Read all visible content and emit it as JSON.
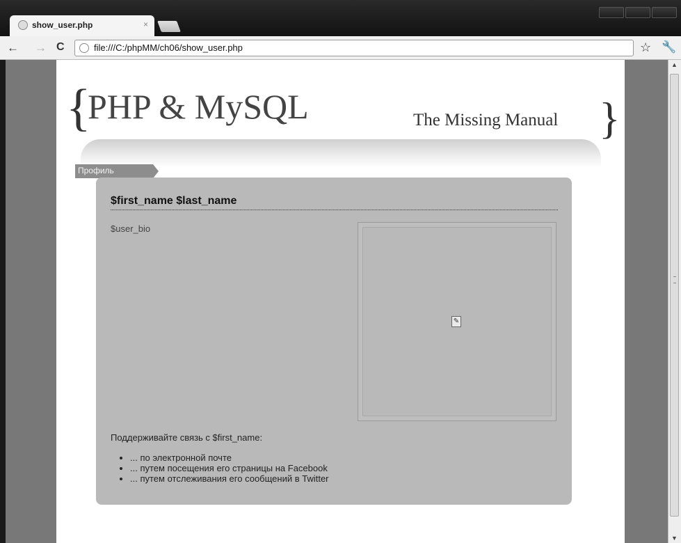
{
  "browser": {
    "tab_title": "show_user.php",
    "tab_close": "×",
    "url": "file:///C:/phpMM/ch06/show_user.php",
    "back": "←",
    "forward": "→",
    "reload": "C",
    "star": "☆",
    "wrench": "🔧"
  },
  "header": {
    "brace_left": "{",
    "title": "PHP & MySQL",
    "subtitle": "The Missing Manual",
    "brace_right": "}"
  },
  "breadcrumb": "Профиль",
  "profile": {
    "name": "$first_name $last_name",
    "bio": "$user_bio",
    "contact_heading": "Поддерживайте связь с $first_name:",
    "links": [
      "... по электронной почте",
      "... путем посещения его страницы на Facebook",
      "... путем отслеживания его сообщений в Twitter"
    ]
  },
  "scrollbar": {
    "up": "▲",
    "down": "▼"
  },
  "colors": {
    "card": "#b9b9b9",
    "page_bg": "#787878",
    "crumb": "#8d8d8d"
  }
}
